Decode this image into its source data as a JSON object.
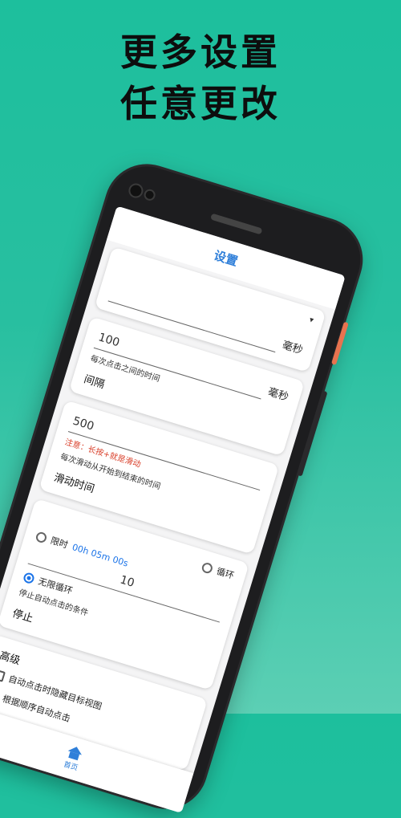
{
  "headline": {
    "line1": "更多设置",
    "line2": "任意更改"
  },
  "app": {
    "title": "设置"
  },
  "dropdown": {
    "symbol": "▾"
  },
  "card1": {
    "unit": "毫秒"
  },
  "card2": {
    "value": "100",
    "hint": "每次点击之间的时间",
    "label": "间隔",
    "unit": "毫秒"
  },
  "card3": {
    "value": "500",
    "warning": "注意：长按+就是滑动",
    "hint": "每次滑动从开始到结束的时间",
    "label": "滑动时间"
  },
  "card4": {
    "loop_option": "循环",
    "timed_option": "限时",
    "timed_value": "00h 05m 00s",
    "count_value": "10",
    "infinite_option": "无限循环",
    "hint": "停止自动点击的条件",
    "label": "停止",
    "selected": "无限循环"
  },
  "card5": {
    "label": "高级",
    "options": [
      {
        "text": "自动点击时隐藏目标视图",
        "checked": false
      },
      {
        "text": "根据顺序自动点击",
        "checked": true
      }
    ]
  },
  "nav": {
    "home_label": "首页"
  },
  "colors": {
    "accent": "#1a73e8",
    "warning": "#d9402b",
    "background": "#24bf9e"
  }
}
